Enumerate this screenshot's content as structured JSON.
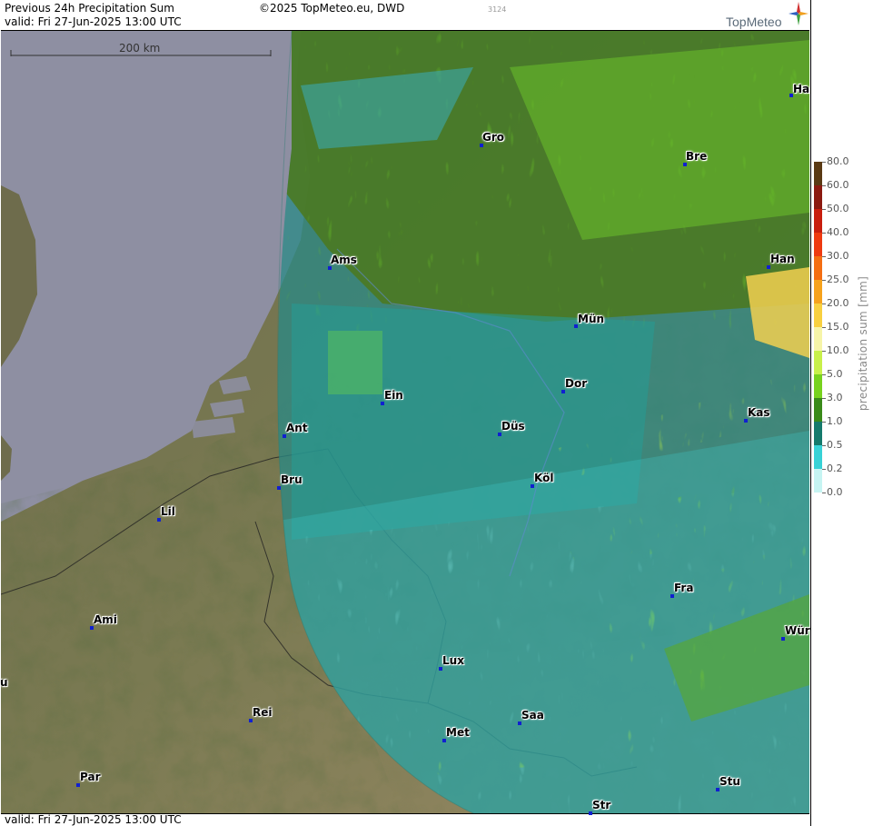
{
  "header": {
    "title": "Previous 24h Precipitation Sum",
    "valid_top": "valid:  Fri  27-Jun-2025 13:00 UTC",
    "copyright": "©2025 TopMeteo.eu, DWD",
    "code": "3124",
    "logo_text": "TopMeteo"
  },
  "footer": {
    "valid_bottom": "valid:  Fri  27-Jun-2025 13:00 UTC"
  },
  "scale": {
    "label": "200 km"
  },
  "cities": [
    {
      "name": "Gro"
    },
    {
      "name": "Bre"
    },
    {
      "name": "Ha"
    },
    {
      "name": "Ams"
    },
    {
      "name": "Han"
    },
    {
      "name": "Mün"
    },
    {
      "name": "Ein"
    },
    {
      "name": "Dor"
    },
    {
      "name": "Düs"
    },
    {
      "name": "Kas"
    },
    {
      "name": "Ant"
    },
    {
      "name": "Bru"
    },
    {
      "name": "Köl"
    },
    {
      "name": "Lil"
    },
    {
      "name": "Fra"
    },
    {
      "name": "Ami"
    },
    {
      "name": "Wür"
    },
    {
      "name": "Lux"
    },
    {
      "name": "u"
    },
    {
      "name": "Rei"
    },
    {
      "name": "Saa"
    },
    {
      "name": "Met"
    },
    {
      "name": "Par"
    },
    {
      "name": "Stu"
    },
    {
      "name": "Str"
    }
  ],
  "legend": {
    "title": "precipitation sum [mm]",
    "levels": [
      {
        "label": "80.0",
        "color": "#5a3a14"
      },
      {
        "label": "60.0",
        "color": "#8b1a10"
      },
      {
        "label": "50.0",
        "color": "#c81e0e"
      },
      {
        "label": "40.0",
        "color": "#ee3a10"
      },
      {
        "label": "30.0",
        "color": "#f46e12"
      },
      {
        "label": "25.0",
        "color": "#f6a21c"
      },
      {
        "label": "20.0",
        "color": "#f8d040"
      },
      {
        "label": "15.0",
        "color": "#f6f4a8"
      },
      {
        "label": "10.0",
        "color": "#c8f04a"
      },
      {
        "label": "5.0",
        "color": "#78d21e"
      },
      {
        "label": "3.0",
        "color": "#3a8a1a"
      },
      {
        "label": "1.0",
        "color": "#157a6c"
      },
      {
        "label": "0.5",
        "color": "#38d2d6"
      },
      {
        "label": "0.2",
        "color": "#c6f4f2"
      },
      {
        "label": "0.0",
        "color": "#ffffff"
      }
    ]
  }
}
